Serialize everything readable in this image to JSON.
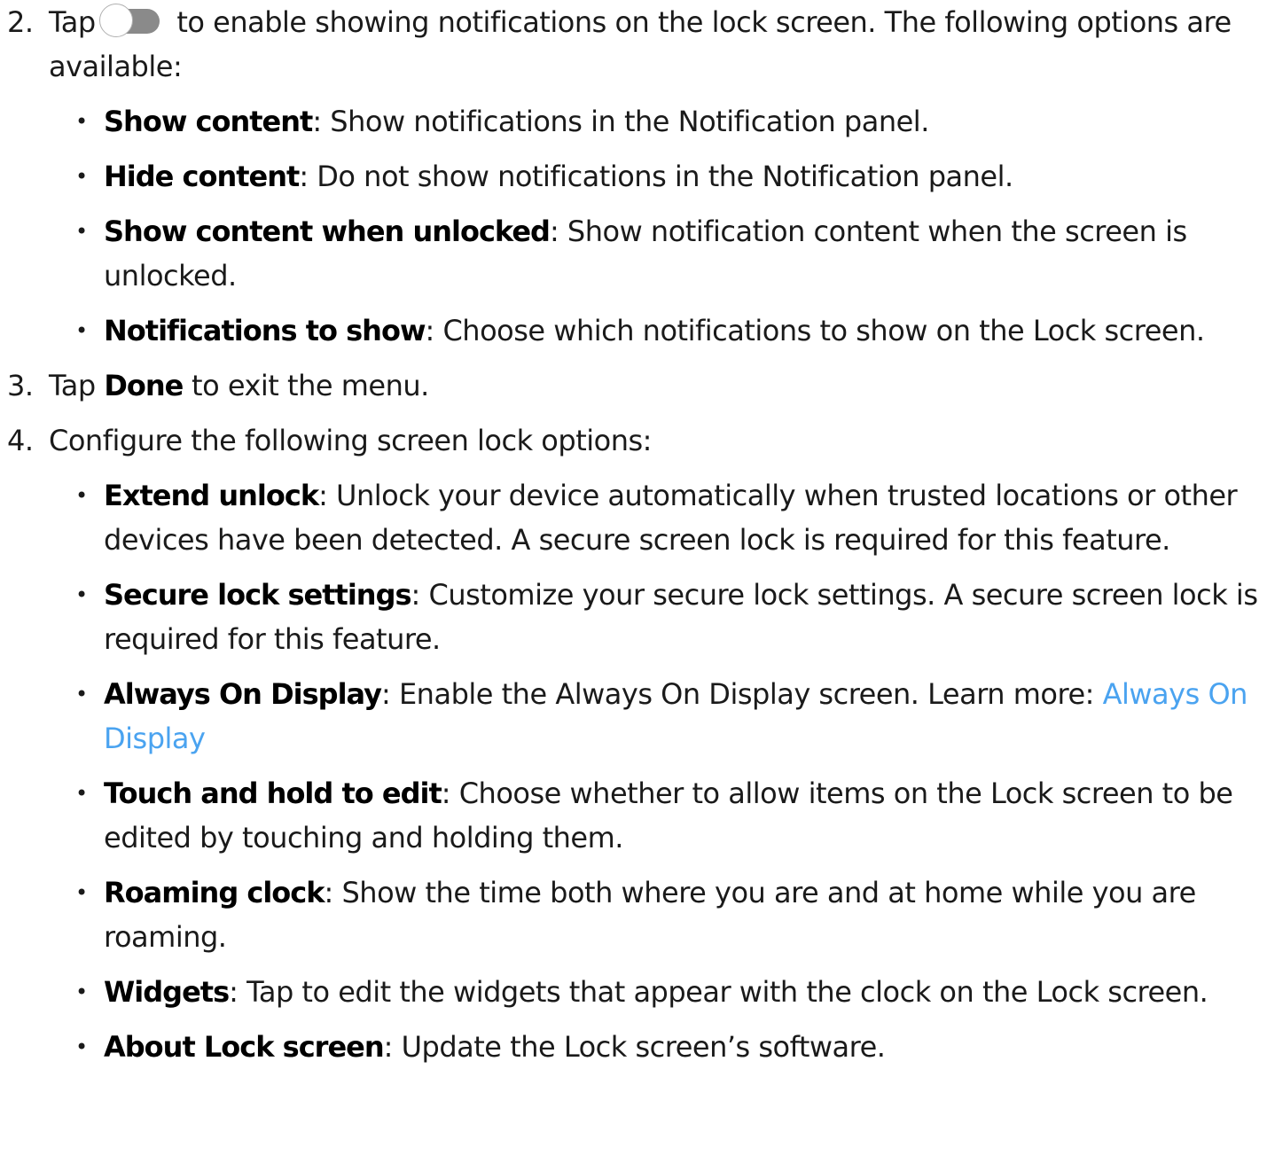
{
  "steps": [
    {
      "number": "2.",
      "pre": "Tap",
      "post": " to enable showing notifications on the lock screen. The following options are available:",
      "toggle_icon": "toggle-off-icon",
      "items": [
        {
          "term": "Show content",
          "desc": ": Show notifications in the Notification panel."
        },
        {
          "term": "Hide content",
          "desc": ": Do not show notifications in the Notification panel."
        },
        {
          "term": "Show content when unlocked",
          "desc": ": Show notification content when the screen is unlocked."
        },
        {
          "term": "Notifications to show",
          "desc": ": Choose which notifications to show on the Lock screen."
        }
      ]
    },
    {
      "number": "3.",
      "pre": "Tap ",
      "term": "Done",
      "post": " to exit the menu."
    },
    {
      "number": "4.",
      "text": "Configure the following screen lock options:",
      "items": [
        {
          "term": "Extend unlock",
          "desc": ": Unlock your device automatically when trusted locations or other devices have been detected. A secure screen lock is required for this feature."
        },
        {
          "term": "Secure lock settings",
          "desc": ": Customize your secure lock settings. A secure screen lock is required for this feature."
        },
        {
          "term": "Always On Display",
          "desc": ": Enable the Always On Display screen. Learn more: ",
          "link": "Always On Display"
        },
        {
          "term": "Touch and hold to edit",
          "desc": ": Choose whether to allow items on the Lock screen to be edited by touching and holding them."
        },
        {
          "term": "Roaming clock",
          "desc": ": Show the time both where you are and at home while you are roaming."
        },
        {
          "term": "Widgets",
          "desc": ": Tap to edit the widgets that appear with the clock on the Lock screen."
        },
        {
          "term": "About Lock screen",
          "desc": ": Update the Lock screen’s software."
        }
      ]
    }
  ],
  "bullet_glyph": "•",
  "colors": {
    "text": "#1a1a1a",
    "link": "#4aa3f0",
    "toggle_track": "#8a8a8a"
  }
}
